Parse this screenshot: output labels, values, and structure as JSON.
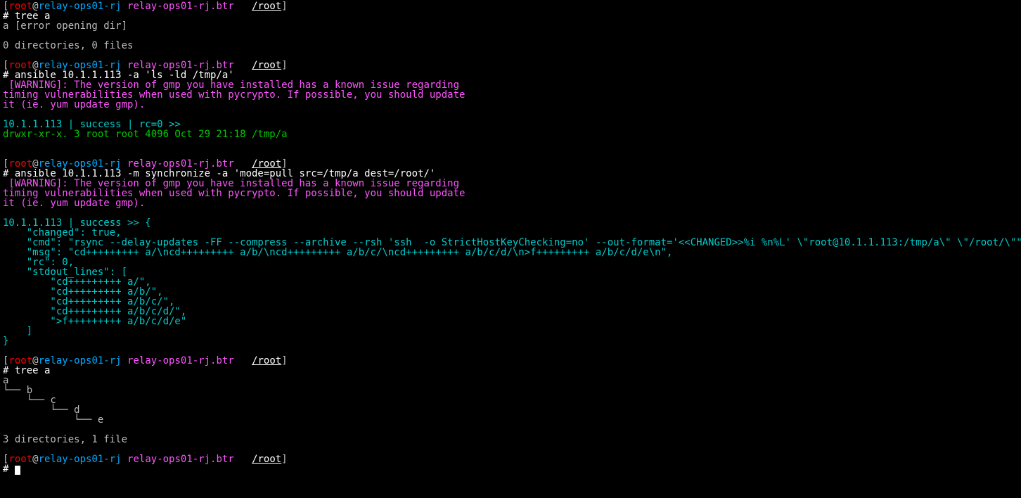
{
  "prompt": {
    "lb": "[",
    "user": "root",
    "at": "@",
    "host": "relay-ops01-rj",
    "space": " ",
    "fqdn": "relay-ops01-rj.btr",
    "sep": "   ",
    "cwd": "/root",
    "rb": "]",
    "hash": "# "
  },
  "block1": {
    "cmd": "tree a",
    "out": "a [error opening dir]\n\n0 directories, 0 files\n"
  },
  "block2": {
    "cmd": "ansible 10.1.1.113 -a 'ls -ld /tmp/a'",
    "warn": " [WARNING]: The version of gmp you have installed has a known issue regarding\ntiming vulnerabilities when used with pycrypto. If possible, you should update\nit (ie. yum update gmp).\n",
    "out_cyan": "10.1.1.113 | success | rc=0 >>",
    "out_grn": "drwxr-xr-x. 3 root root 4096 Oct 29 21:18 /tmp/a"
  },
  "block3": {
    "cmd": "ansible 10.1.1.113 -m synchronize -a 'mode=pull src=/tmp/a dest=/root/'",
    "warn": " [WARNING]: The version of gmp you have installed has a known issue regarding\ntiming vulnerabilities when used with pycrypto. If possible, you should update\nit (ie. yum update gmp).\n",
    "out_cyan": "10.1.1.113 | success >> {\n    \"changed\": true, \n    \"cmd\": \"rsync --delay-updates -FF --compress --archive --rsh 'ssh  -o StrictHostKeyChecking=no' --out-format='<<CHANGED>>%i %n%L' \\\"root@10.1.1.113:/tmp/a\\\" \\\"/root/\\\"\", \n    \"msg\": \"cd+++++++++ a/\\ncd+++++++++ a/b/\\ncd+++++++++ a/b/c/\\ncd+++++++++ a/b/c/d/\\n>f+++++++++ a/b/c/d/e\\n\", \n    \"rc\": 0, \n    \"stdout_lines\": [\n        \"cd+++++++++ a/\", \n        \"cd+++++++++ a/b/\", \n        \"cd+++++++++ a/b/c/\", \n        \"cd+++++++++ a/b/c/d/\", \n        \">f+++++++++ a/b/c/d/e\"\n    ]\n}"
  },
  "block4": {
    "cmd": "tree a",
    "out": "a\n└── b\n    └── c\n        └── d\n            └── e\n\n3 directories, 1 file\n"
  }
}
